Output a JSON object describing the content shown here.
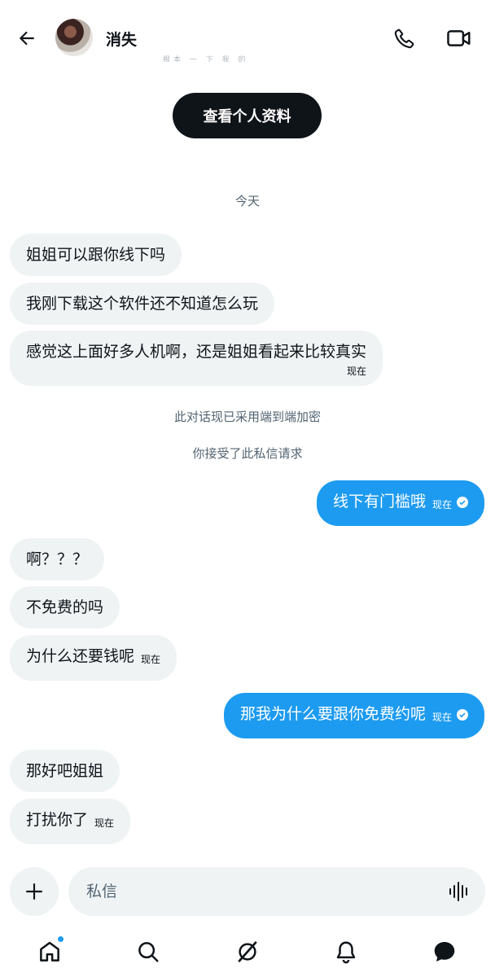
{
  "header": {
    "title": "消失",
    "faded_text": "根本   一   下   我   的",
    "icons": {
      "back": "arrow-left-icon",
      "call": "phone-icon",
      "video": "video-camera-icon"
    }
  },
  "profile": {
    "view_profile_label": "查看个人资料"
  },
  "notes": {
    "date": "今天",
    "encryption": "此对话现已采用端到端加密",
    "accepted": "你接受了此私信请求"
  },
  "messages": [
    {
      "dir": "in",
      "text": "姐姐可以跟你线下吗"
    },
    {
      "dir": "in",
      "text": "我刚下载这个软件还不知道怎么玩"
    },
    {
      "dir": "in",
      "text": "感觉这上面好多人机啊，还是姐姐看起来比较真实",
      "time": "现在"
    },
    {
      "dir": "out",
      "text": "线下有门槛哦",
      "time": "现在"
    },
    {
      "dir": "in",
      "text": "啊？？？"
    },
    {
      "dir": "in",
      "text": "不免费的吗"
    },
    {
      "dir": "in",
      "text": "为什么还要钱呢",
      "time": "现在"
    },
    {
      "dir": "out",
      "text": "那我为什么要跟你免费约呢",
      "time": "现在"
    },
    {
      "dir": "in",
      "text": "那好吧姐姐"
    },
    {
      "dir": "in",
      "text": "打扰你了",
      "time": "现在"
    }
  ],
  "composer": {
    "placeholder": "私信",
    "icons": {
      "add": "plus-icon",
      "voice": "voice-wave-icon"
    }
  },
  "bottom_nav": {
    "items": [
      "home-icon",
      "search-icon",
      "grok-icon",
      "notifications-icon",
      "messages-icon"
    ]
  },
  "colors": {
    "accent": "#1d9bf0",
    "incoming_bubble": "#eff3f4",
    "dark_button": "#0f1419",
    "muted_text": "#536471"
  }
}
